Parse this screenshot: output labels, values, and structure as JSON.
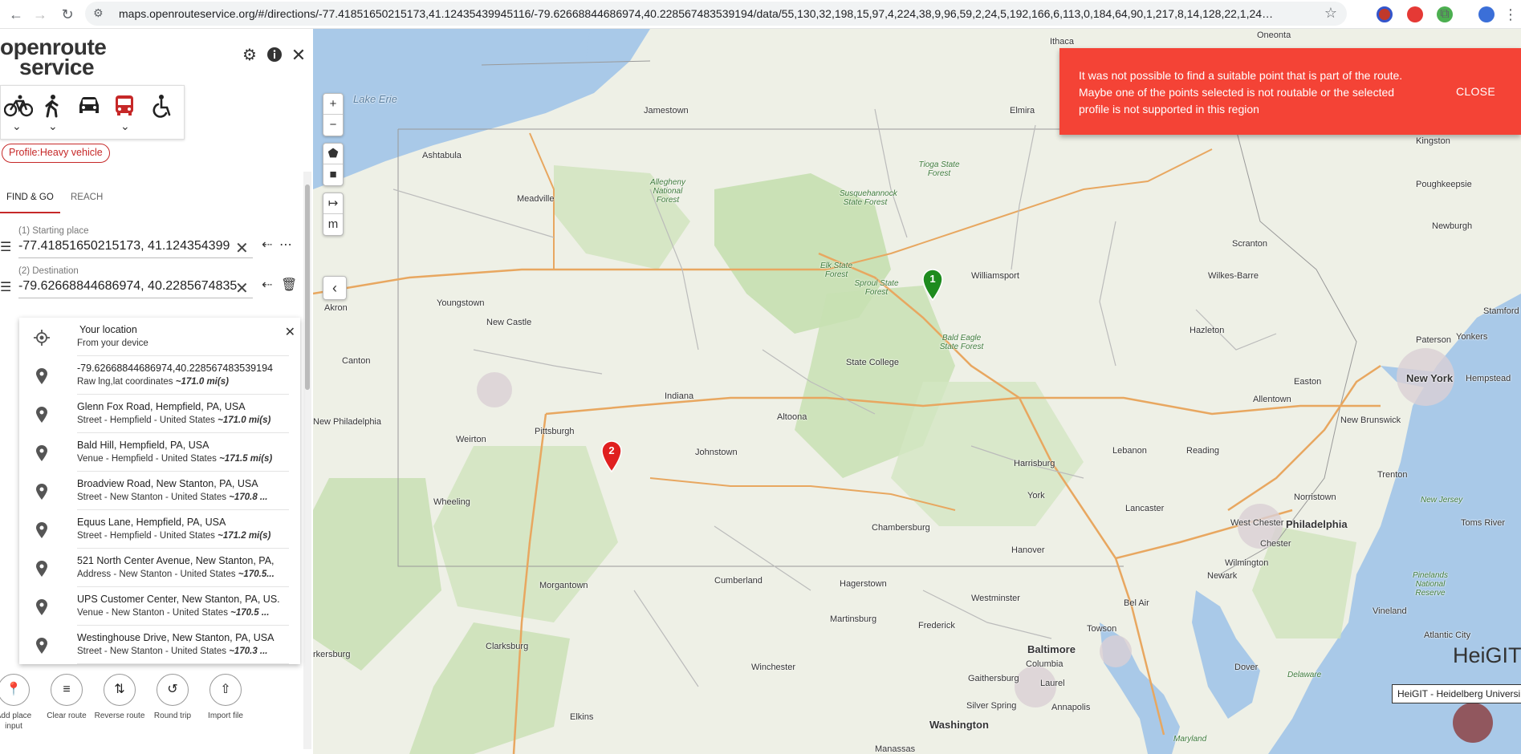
{
  "browser": {
    "url": "maps.openrouteservice.org/#/directions/-77.41851650215173,41.12435439945116/-79.62668844686974,40.228567483539194/data/55,130,32,198,15,97,4,224,38,9,96,59,2,24,5,192,166,6,113,0,184,64,90,1,217,8,14,128,22,1,24,0,224,21,130,128,2..."
  },
  "sidebar": {
    "logo_line1": "openroute",
    "logo_line2": "service",
    "profile_chip": "Profile:Heavy vehicle",
    "tabs": [
      "FIND & GO",
      "REACH"
    ],
    "waypoints": [
      {
        "label": "(1) Starting place",
        "value": "-77.41851650215173, 41.124354399"
      },
      {
        "label": "(2) Destination",
        "value": "-79.62668844686974, 40.2285674835"
      }
    ],
    "suggestions": {
      "location_title": "Your location",
      "location_sub": "From your device",
      "items": [
        {
          "title": "-79.62668844686974,40.228567483539194",
          "sub": "Raw lng,lat coordinates",
          "dist": "~171.0 mi(s)"
        },
        {
          "title": "Glenn Fox Road, Hempfield, PA, USA",
          "sub": "Street - Hempfield - United States",
          "dist": "~171.0 mi(s)"
        },
        {
          "title": "Bald Hill, Hempfield, PA, USA",
          "sub": "Venue - Hempfield - United States",
          "dist": "~171.5 mi(s)"
        },
        {
          "title": "Broadview Road, New Stanton, PA, USA",
          "sub": "Street - New Stanton - United States",
          "dist": "~170.8 ..."
        },
        {
          "title": "Equus Lane, Hempfield, PA, USA",
          "sub": "Street - Hempfield - United States",
          "dist": "~171.2 mi(s)"
        },
        {
          "title": "521 North Center Avenue, New Stanton, PA,",
          "sub": "Address - New Stanton - United States",
          "dist": "~170.5..."
        },
        {
          "title": "UPS Customer Center, New Stanton, PA, US.",
          "sub": "Venue - New Stanton - United States",
          "dist": "~170.5 ..."
        },
        {
          "title": "Westinghouse Drive, New Stanton, PA, USA",
          "sub": "Street - New Stanton - United States",
          "dist": "~170.3 ..."
        }
      ]
    },
    "actions": [
      {
        "icon": "add-place-icon",
        "label": "Add place input"
      },
      {
        "icon": "clear-icon",
        "label": "Clear route"
      },
      {
        "icon": "reverse-icon",
        "label": "Reverse route"
      },
      {
        "icon": "round-trip-icon",
        "label": "Round trip"
      },
      {
        "icon": "upload-icon",
        "label": "Import file"
      }
    ]
  },
  "map": {
    "controls": {
      "zoom_in": "+",
      "zoom_out": "−",
      "measure": "m"
    },
    "markers": [
      {
        "label": "1",
        "color": "#1e8b1e"
      },
      {
        "label": "2",
        "color": "#e02020"
      }
    ],
    "places": {
      "lake": "Lake Erie",
      "ithaca": "Ithaca",
      "oneonta": "Oneonta",
      "jamestown": "Jamestown",
      "elmira": "Elmira",
      "kingston": "Kingston",
      "ashtabula": "Ashtabula",
      "poughkeepsie": "Poughkeepsie",
      "meadville": "Meadville",
      "newburgh": "Newburgh",
      "scranton": "Scranton",
      "wilkes": "Wilkes-Barre",
      "williamsport": "Williamsport",
      "youngstown": "Youngstown",
      "akron": "Akron",
      "newcastle": "New Castle",
      "stamford": "Stamford",
      "hazleton": "Hazleton",
      "paterson": "Paterson",
      "yonkers": "Yonkers",
      "canton": "Canton",
      "statecollege": "State College",
      "newyork": "New York",
      "hempstead": "Hempstead",
      "easton": "Easton",
      "allentown": "Allentown",
      "indiana": "Indiana",
      "newphila": "New Philadelphia",
      "altoona": "Altoona",
      "newbrunswick": "New Brunswick",
      "pittsburgh": "Pittsburgh",
      "weirton": "Weirton",
      "johnstown": "Johnstown",
      "lebanon": "Lebanon",
      "reading": "Reading",
      "harrisburg": "Harrisburg",
      "trenton": "Trenton",
      "wheeling": "Wheeling",
      "norristown": "Norristown",
      "lancaster": "Lancaster",
      "westchester": "West Chester",
      "philadelphia": "Philadelphia",
      "york": "York",
      "chambersburg": "Chambersburg",
      "newjersey": "New Jersey",
      "tomsriver": "Toms River",
      "hanover": "Hanover",
      "chester": "Chester",
      "morgantown": "Morgantown",
      "cumberland": "Cumberland",
      "hagerstown": "Hagerstown",
      "wilmington": "Wilmington",
      "newark": "Newark",
      "westminster": "Westminster",
      "pinelands": "Pinelands National Reserve",
      "clarksburg": "Clarksburg",
      "vineland": "Vineland",
      "martinsburg": "Martinsburg",
      "frederick": "Frederick",
      "belair": "Bel Air",
      "towson": "Towson",
      "atlanticcity": "Atlantic City",
      "baltimore": "Baltimore",
      "winchester": "Winchester",
      "columbia": "Columbia",
      "dover": "Dover",
      "delaware": "Delaware",
      "gaithersburg": "Gaithersburg",
      "laurel": "Laurel",
      "silverspring": "Silver Spring",
      "elkins": "Elkins",
      "annapolis": "Annapolis",
      "washington": "Washington",
      "maryland": "Maryland",
      "manassas": "Manassas",
      "parkersburg": "rkersburg",
      "allegheny": "Allegheny National Forest",
      "tioga": "Tioga State Forest",
      "susquehannock": "Susquehannock State Forest",
      "elk": "Elk State Forest",
      "sproul": "Sproul State Forest",
      "baldeagle": "Bald Eagle State Forest"
    },
    "toast": {
      "message": "It was not possible to find a suitable point that is part of the route. Maybe one of the points selected is not routable or the selected profile is not supported in this region",
      "close": "CLOSE"
    },
    "heigit_logo": "HeiGIT",
    "attribution": "HeiGIT - Heidelberg Universi"
  }
}
